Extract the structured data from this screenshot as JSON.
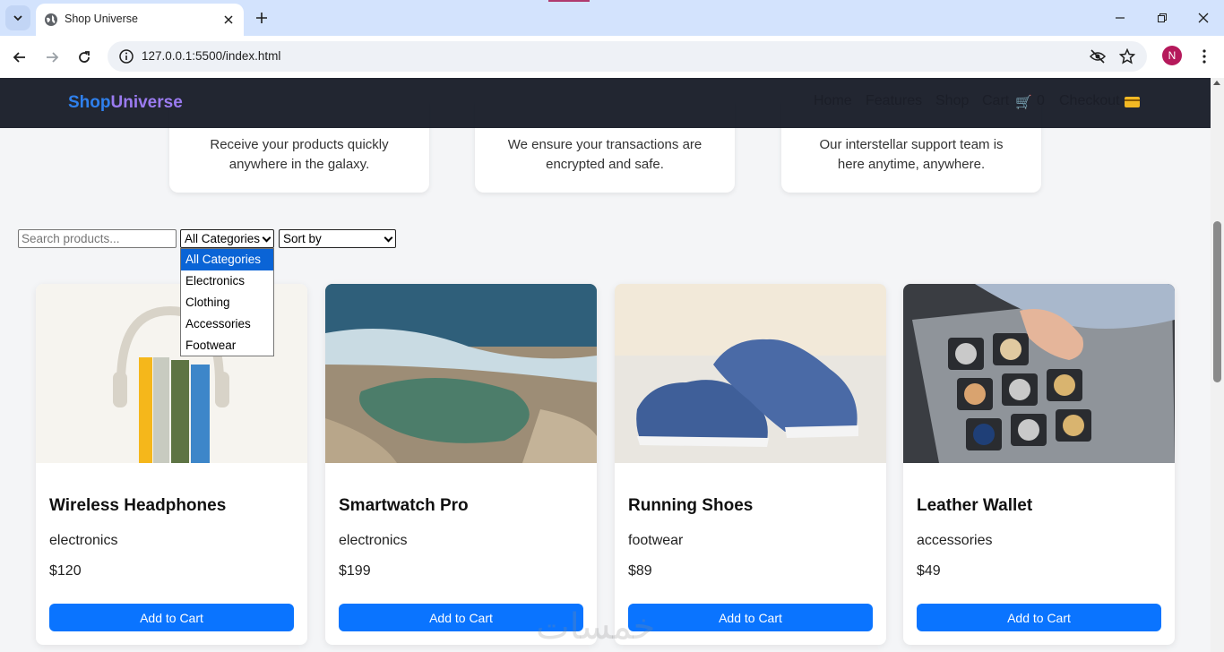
{
  "browser": {
    "tab_title": "Shop Universe",
    "url": "127.0.0.1:5500/index.html",
    "profile_initial": "N"
  },
  "features": [
    {
      "text": "Receive your products quickly anywhere in the galaxy."
    },
    {
      "text": "We ensure your transactions are encrypted and safe."
    },
    {
      "text": "Our interstellar support team is here anytime, anywhere."
    }
  ],
  "header": {
    "logo_part1": "Shop",
    "logo_part2": "Universe",
    "nav": {
      "home": "Home",
      "features": "Features",
      "shop": "Shop",
      "cart": "Cart",
      "cart_count": "0",
      "checkout": "Checkout"
    }
  },
  "filters": {
    "search_placeholder": "Search products...",
    "category_selected": "All Categories",
    "category_options": [
      "All Categories",
      "Electronics",
      "Clothing",
      "Accessories",
      "Footwear"
    ],
    "sort_selected": "Sort by"
  },
  "products": [
    {
      "name": "Wireless Headphones",
      "category": "electronics",
      "price": "$120",
      "button": "Add to Cart",
      "image": "headphones-with-books"
    },
    {
      "name": "Smartwatch Pro",
      "category": "electronics",
      "price": "$199",
      "button": "Add to Cart",
      "image": "rocky-shore-pool"
    },
    {
      "name": "Running Shoes",
      "category": "footwear",
      "price": "$89",
      "button": "Add to Cart",
      "image": "blue-sneakers"
    },
    {
      "name": "Leather Wallet",
      "category": "accessories",
      "price": "$49",
      "button": "Add to Cart",
      "image": "watch-case"
    }
  ],
  "watermark": "خمسات",
  "colors": {
    "header_bg": "#141824",
    "accent_blue": "#0a74ff",
    "logo_blue": "#2f80ed",
    "logo_purple": "#9b7bf0"
  }
}
